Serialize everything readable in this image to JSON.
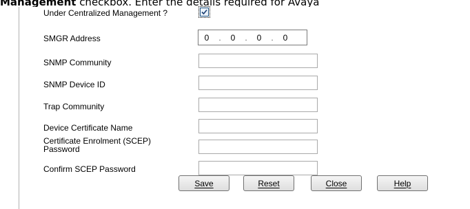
{
  "document": {
    "text_bold": "Management",
    "text_rest": " checkbox. Enter the details required for Avaya"
  },
  "form": {
    "centralized": {
      "label": "Under Centralized Management ?",
      "checked": true
    },
    "smgr": {
      "label": "SMGR Address",
      "octets": [
        "0",
        "0",
        "0",
        "0"
      ]
    },
    "snmp_community": {
      "label": "SNMP Community",
      "value": ""
    },
    "snmp_device_id": {
      "label": "SNMP Device ID",
      "value": ""
    },
    "trap_community": {
      "label": "Trap Community",
      "value": ""
    },
    "device_cert_name": {
      "label": "Device Certificate Name",
      "value": ""
    },
    "scep_password": {
      "label": "Certificate Enrolment (SCEP) Password",
      "value": ""
    },
    "confirm_scep_password": {
      "label": "Confirm SCEP Password",
      "value": ""
    }
  },
  "buttons": {
    "save": "Save",
    "reset": "Reset",
    "close": "Close",
    "help": "Help"
  },
  "icons": {
    "checkbox_check": "checkmark-icon"
  }
}
